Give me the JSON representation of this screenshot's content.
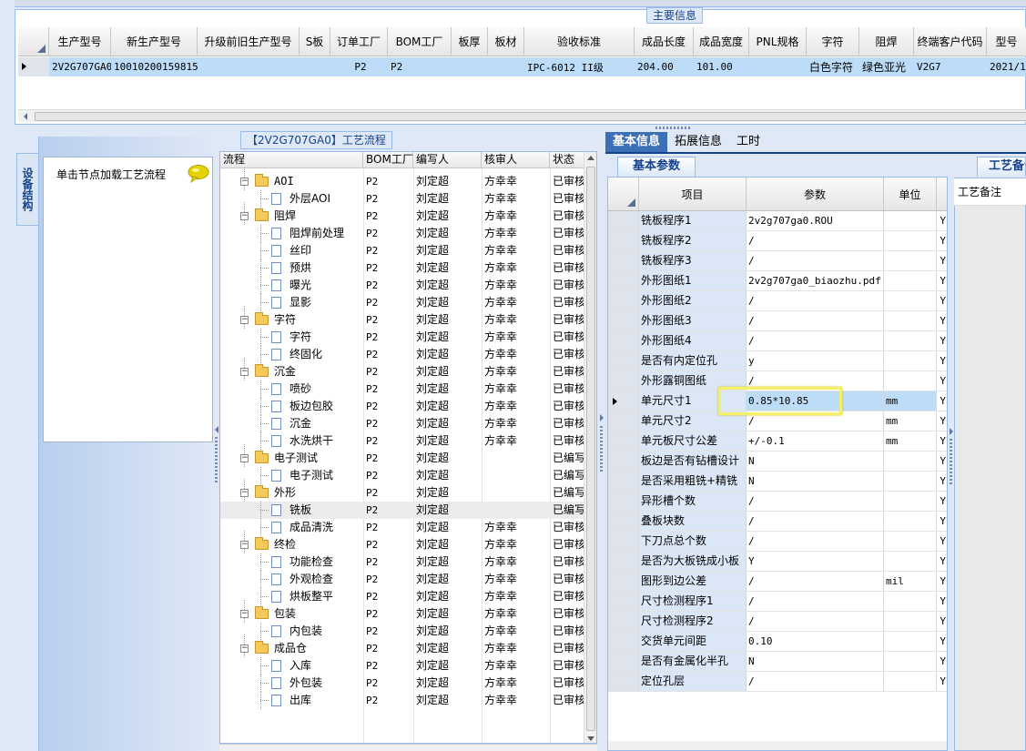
{
  "top_panel": {
    "title": "主要信息",
    "columns": [
      "生产型号",
      "新生产型号",
      "升级前旧生产型号",
      "S板",
      "订单工厂",
      "BOM工厂",
      "板厚",
      "板材",
      "验收标准",
      "成品长度",
      "成品宽度",
      "PNL规格",
      "字符",
      "阻焊",
      "终端客户代码",
      "型号"
    ],
    "row": {
      "prod_model": "2V2G707GA0",
      "new_model": "10010200159815",
      "old_model": "",
      "s_board": "",
      "order_factory": "P2",
      "bom_factory": "P2",
      "thickness": "",
      "material": "",
      "standard": "IPC-6012 II级",
      "length": "204.00",
      "width": "101.00",
      "pnl": "",
      "legend": "白色字符",
      "solder_mask": "绿色亚光",
      "customer_code": "V2G7",
      "date": "2021/1"
    }
  },
  "left_panel": {
    "side_tab": "设备结构",
    "hint": "单击节点加载工艺流程",
    "hint_icon": "speech-bubble-icon"
  },
  "flow": {
    "title": "【2V2G707GA0】工艺流程",
    "columns": [
      "流程",
      "BOM工厂",
      "编写人",
      "核审人",
      "状态"
    ],
    "rows": [
      {
        "level": 0,
        "type": "folder",
        "name": "AOI",
        "factory": "P2",
        "writer": "刘定超",
        "reviewer": "方幸幸",
        "status": "已审核"
      },
      {
        "level": 1,
        "type": "doc",
        "name": "外层AOI",
        "factory": "P2",
        "writer": "刘定超",
        "reviewer": "方幸幸",
        "status": "已审核"
      },
      {
        "level": 0,
        "type": "folder",
        "name": "阻焊",
        "factory": "P2",
        "writer": "刘定超",
        "reviewer": "方幸幸",
        "status": "已审核"
      },
      {
        "level": 1,
        "type": "doc",
        "name": "阻焊前处理",
        "factory": "P2",
        "writer": "刘定超",
        "reviewer": "方幸幸",
        "status": "已审核"
      },
      {
        "level": 1,
        "type": "doc",
        "name": "丝印",
        "factory": "P2",
        "writer": "刘定超",
        "reviewer": "方幸幸",
        "status": "已审核"
      },
      {
        "level": 1,
        "type": "doc",
        "name": "预烘",
        "factory": "P2",
        "writer": "刘定超",
        "reviewer": "方幸幸",
        "status": "已审核"
      },
      {
        "level": 1,
        "type": "doc",
        "name": "曝光",
        "factory": "P2",
        "writer": "刘定超",
        "reviewer": "方幸幸",
        "status": "已审核"
      },
      {
        "level": 1,
        "type": "doc",
        "name": "显影",
        "factory": "P2",
        "writer": "刘定超",
        "reviewer": "方幸幸",
        "status": "已审核"
      },
      {
        "level": 0,
        "type": "folder",
        "name": "字符",
        "factory": "P2",
        "writer": "刘定超",
        "reviewer": "方幸幸",
        "status": "已审核"
      },
      {
        "level": 1,
        "type": "doc",
        "name": "字符",
        "factory": "P2",
        "writer": "刘定超",
        "reviewer": "方幸幸",
        "status": "已审核"
      },
      {
        "level": 1,
        "type": "doc",
        "name": "终固化",
        "factory": "P2",
        "writer": "刘定超",
        "reviewer": "方幸幸",
        "status": "已审核"
      },
      {
        "level": 0,
        "type": "folder",
        "name": "沉金",
        "factory": "P2",
        "writer": "刘定超",
        "reviewer": "方幸幸",
        "status": "已审核"
      },
      {
        "level": 1,
        "type": "doc",
        "name": "喷砂",
        "factory": "P2",
        "writer": "刘定超",
        "reviewer": "方幸幸",
        "status": "已审核"
      },
      {
        "level": 1,
        "type": "doc",
        "name": "板边包胶",
        "factory": "P2",
        "writer": "刘定超",
        "reviewer": "方幸幸",
        "status": "已审核"
      },
      {
        "level": 1,
        "type": "doc",
        "name": "沉金",
        "factory": "P2",
        "writer": "刘定超",
        "reviewer": "方幸幸",
        "status": "已审核"
      },
      {
        "level": 1,
        "type": "doc",
        "name": "水洗烘干",
        "factory": "P2",
        "writer": "刘定超",
        "reviewer": "方幸幸",
        "status": "已审核"
      },
      {
        "level": 0,
        "type": "folder",
        "name": "电子测试",
        "factory": "P2",
        "writer": "刘定超",
        "reviewer": "",
        "status": "已编写"
      },
      {
        "level": 1,
        "type": "doc",
        "name": "电子测试",
        "factory": "P2",
        "writer": "刘定超",
        "reviewer": "",
        "status": "已编写"
      },
      {
        "level": 0,
        "type": "folder",
        "name": "外形",
        "factory": "P2",
        "writer": "刘定超",
        "reviewer": "",
        "status": "已编写"
      },
      {
        "level": 1,
        "type": "doc",
        "name": "铣板",
        "factory": "P2",
        "writer": "刘定超",
        "reviewer": "",
        "status": "已编写",
        "selected": true
      },
      {
        "level": 1,
        "type": "doc",
        "name": "成品清洗",
        "factory": "P2",
        "writer": "刘定超",
        "reviewer": "方幸幸",
        "status": "已审核"
      },
      {
        "level": 0,
        "type": "folder",
        "name": "终检",
        "factory": "P2",
        "writer": "刘定超",
        "reviewer": "方幸幸",
        "status": "已审核"
      },
      {
        "level": 1,
        "type": "doc",
        "name": "功能检查",
        "factory": "P2",
        "writer": "刘定超",
        "reviewer": "方幸幸",
        "status": "已审核"
      },
      {
        "level": 1,
        "type": "doc",
        "name": "外观检查",
        "factory": "P2",
        "writer": "刘定超",
        "reviewer": "方幸幸",
        "status": "已审核"
      },
      {
        "level": 1,
        "type": "doc",
        "name": "烘板整平",
        "factory": "P2",
        "writer": "刘定超",
        "reviewer": "方幸幸",
        "status": "已审核"
      },
      {
        "level": 0,
        "type": "folder",
        "name": "包装",
        "factory": "P2",
        "writer": "刘定超",
        "reviewer": "方幸幸",
        "status": "已审核"
      },
      {
        "level": 1,
        "type": "doc",
        "name": "内包装",
        "factory": "P2",
        "writer": "刘定超",
        "reviewer": "方幸幸",
        "status": "已审核"
      },
      {
        "level": 0,
        "type": "folder",
        "name": "成品仓",
        "factory": "P2",
        "writer": "刘定超",
        "reviewer": "方幸幸",
        "status": "已审核"
      },
      {
        "level": 1,
        "type": "doc",
        "name": "入库",
        "factory": "P2",
        "writer": "刘定超",
        "reviewer": "方幸幸",
        "status": "已审核"
      },
      {
        "level": 1,
        "type": "doc",
        "name": "外包装",
        "factory": "P2",
        "writer": "刘定超",
        "reviewer": "方幸幸",
        "status": "已审核"
      },
      {
        "level": 1,
        "type": "doc",
        "name": "出库",
        "factory": "P2",
        "writer": "刘定超",
        "reviewer": "方幸幸",
        "status": "已审核"
      }
    ]
  },
  "right_tabs": {
    "tabs": [
      "基本信息",
      "拓展信息",
      "工时"
    ],
    "active": 0
  },
  "params": {
    "tab_label": "基本参数",
    "columns": [
      "项目",
      "参数",
      "单位"
    ],
    "rows": [
      {
        "item": "铣板程序1",
        "value": "2v2g707ga0.ROU",
        "unit": "",
        "flag": "Y"
      },
      {
        "item": "铣板程序2",
        "value": "/",
        "unit": "",
        "flag": "Y"
      },
      {
        "item": "铣板程序3",
        "value": "/",
        "unit": "",
        "flag": "Y"
      },
      {
        "item": "外形图纸1",
        "value": "2v2g707ga0_biaozhu.pdf",
        "unit": "",
        "flag": "Y"
      },
      {
        "item": "外形图纸2",
        "value": "/",
        "unit": "",
        "flag": "Y"
      },
      {
        "item": "外形图纸3",
        "value": "/",
        "unit": "",
        "flag": "Y"
      },
      {
        "item": "外形图纸4",
        "value": "/",
        "unit": "",
        "flag": "Y"
      },
      {
        "item": "是否有内定位孔",
        "value": "y",
        "unit": "",
        "flag": "Y"
      },
      {
        "item": "外形露铜图纸",
        "value": "/",
        "unit": "",
        "flag": "Y"
      },
      {
        "item": "单元尺寸1",
        "value": "0.85*10.85",
        "unit": "mm",
        "flag": "Y",
        "current": true
      },
      {
        "item": "单元尺寸2",
        "value": "/",
        "unit": "mm",
        "flag": "Y"
      },
      {
        "item": "单元板尺寸公差",
        "value": "+/-0.1",
        "unit": "mm",
        "flag": "Y"
      },
      {
        "item": "板边是否有钻槽设计",
        "value": "N",
        "unit": "",
        "flag": "Y"
      },
      {
        "item": "是否采用粗铣+精铣",
        "value": "N",
        "unit": "",
        "flag": "Y"
      },
      {
        "item": "异形槽个数",
        "value": "/",
        "unit": "",
        "flag": "Y"
      },
      {
        "item": "叠板块数",
        "value": "/",
        "unit": "",
        "flag": "Y"
      },
      {
        "item": "下刀点总个数",
        "value": "/",
        "unit": "",
        "flag": "Y"
      },
      {
        "item": "是否为大板铣成小板",
        "value": "Y",
        "unit": "",
        "flag": "Y"
      },
      {
        "item": "图形到边公差",
        "value": "/",
        "unit": "mil",
        "flag": "Y"
      },
      {
        "item": "尺寸检测程序1",
        "value": "/",
        "unit": "",
        "flag": "Y"
      },
      {
        "item": "尺寸检测程序2",
        "value": "/",
        "unit": "",
        "flag": "Y"
      },
      {
        "item": "交货单元间距",
        "value": "0.10",
        "unit": "",
        "flag": "Y"
      },
      {
        "item": "是否有金属化半孔",
        "value": "N",
        "unit": "",
        "flag": "Y"
      },
      {
        "item": "定位孔层",
        "value": "/",
        "unit": "",
        "flag": "Y"
      }
    ]
  },
  "craft": {
    "tab_label": "工艺备注",
    "note_label": "工艺备注"
  }
}
